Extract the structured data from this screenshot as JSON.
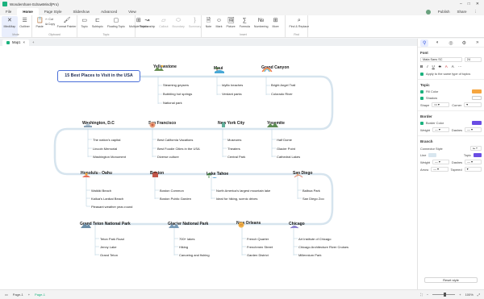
{
  "window": {
    "title": "Wondershare EdrawMind(Pro)",
    "controls": [
      "–",
      "□",
      "✕"
    ]
  },
  "menu": {
    "tabs": [
      "File",
      "Home",
      "Page Style",
      "Slideshow",
      "Advanced",
      "View"
    ],
    "active_tab": "Home",
    "publish": "Publish",
    "share": "Share"
  },
  "ribbon": {
    "mode": {
      "label": "Mode",
      "buttons": [
        "MindMap",
        "Outliner"
      ]
    },
    "clipboard": {
      "label": "Clipboard",
      "paste": "Paste",
      "cut": "Cut",
      "copy": "Copy",
      "format_painter": "Format Painter"
    },
    "topic": {
      "label": "Topic",
      "buttons": [
        "Topic",
        "Subtopic",
        "Floating Topic",
        "Multiple Topics"
      ]
    },
    "insert_rel": {
      "buttons": [
        "Relationship",
        "Callout",
        "Boundary",
        "Summary"
      ]
    },
    "insert": {
      "label": "Insert",
      "buttons": [
        "Note",
        "Mark",
        "Picture",
        "Formula",
        "Numbering",
        "More"
      ]
    },
    "find": {
      "label": "Find",
      "button": "Find & Replace"
    }
  },
  "doc_tab": {
    "label": "Map1"
  },
  "mindmap": {
    "central": "15 Best Places to Visit in the USA",
    "places": [
      {
        "name": "Yellowstone",
        "items": [
          "Steaming geysers",
          "Bubbling hot springs",
          "National park"
        ]
      },
      {
        "name": "Maui",
        "items": [
          "Idyllic beaches",
          "Verdant parks"
        ]
      },
      {
        "name": "Grand Canyon",
        "items": [
          "Bright Angel Trail",
          "Colorado River"
        ]
      },
      {
        "name": "Washington, D.C",
        "items": [
          "The nation's capital",
          "Lincoln Memorial",
          "Washington Monument"
        ]
      },
      {
        "name": "San Francisco",
        "items": [
          "Best California Vacations",
          "Best Foodie Cities in the USA",
          "Diverse culture"
        ]
      },
      {
        "name": "New York City",
        "items": [
          "Museums",
          "Theaters",
          "Central Park"
        ]
      },
      {
        "name": "Yosemite",
        "items": [
          "Half Dome",
          "Glacier Point",
          "Cathedral Lakes"
        ]
      },
      {
        "name": "Honolulu - Oahu",
        "items": [
          "Waikiki Beach",
          "Kailua's Lanikai Beach",
          "Pleasant weather year-round"
        ]
      },
      {
        "name": "Boston",
        "items": [
          "Boston Common",
          "Boston Public Garden"
        ]
      },
      {
        "name": "Lake Tahoe",
        "items": [
          "North America's largest mountain lake",
          "Ideal for hiking, scenic drives"
        ]
      },
      {
        "name": "San Diego",
        "items": [
          "Balboa Park",
          "San Diego Zoo"
        ]
      },
      {
        "name": "Grand Teton National Park",
        "items": [
          "Teton Park Road",
          "Jenny Lake",
          "Grand Teton"
        ]
      },
      {
        "name": "Glacier National Park",
        "items": [
          "700+ lakes",
          "Hiking",
          "Canoeing and fishing"
        ]
      },
      {
        "name": "New Orleans",
        "items": [
          "French Quarter",
          "Frenchmen Street",
          "Garden District"
        ]
      },
      {
        "name": "Chicago",
        "items": [
          "Art Institute of Chicago",
          "Chicago Architecture River Cruises",
          "Millennium Park"
        ]
      }
    ]
  },
  "panel": {
    "font_title": "Font",
    "font_family": "Mata Sans SC",
    "font_size": "24",
    "apply_same": "Apply to the same type of topics",
    "topic_title": "Topic",
    "fill_color": "Fill Color",
    "shadow": "Shadow",
    "shape": "Shape",
    "corner": "Corner",
    "border_title": "Border",
    "border_color": "Border Color",
    "weight": "Weight",
    "dashes": "Dashes",
    "branch_title": "Branch",
    "connector_style": "Connector Style",
    "line": "Line",
    "topic_label": "Topic",
    "weight2": "Weight",
    "dashes2": "Dashes",
    "arrow": "Arrow",
    "tapered": "Tapered",
    "reset": "Reset style",
    "colors": {
      "fill": "#f6a640",
      "border": "#6a4de3",
      "topic_line": "#6a4de3",
      "line": "#d8e6ef"
    }
  },
  "status": {
    "page": "Page-1",
    "page_tab": "Page-1",
    "zoom": "100%"
  }
}
